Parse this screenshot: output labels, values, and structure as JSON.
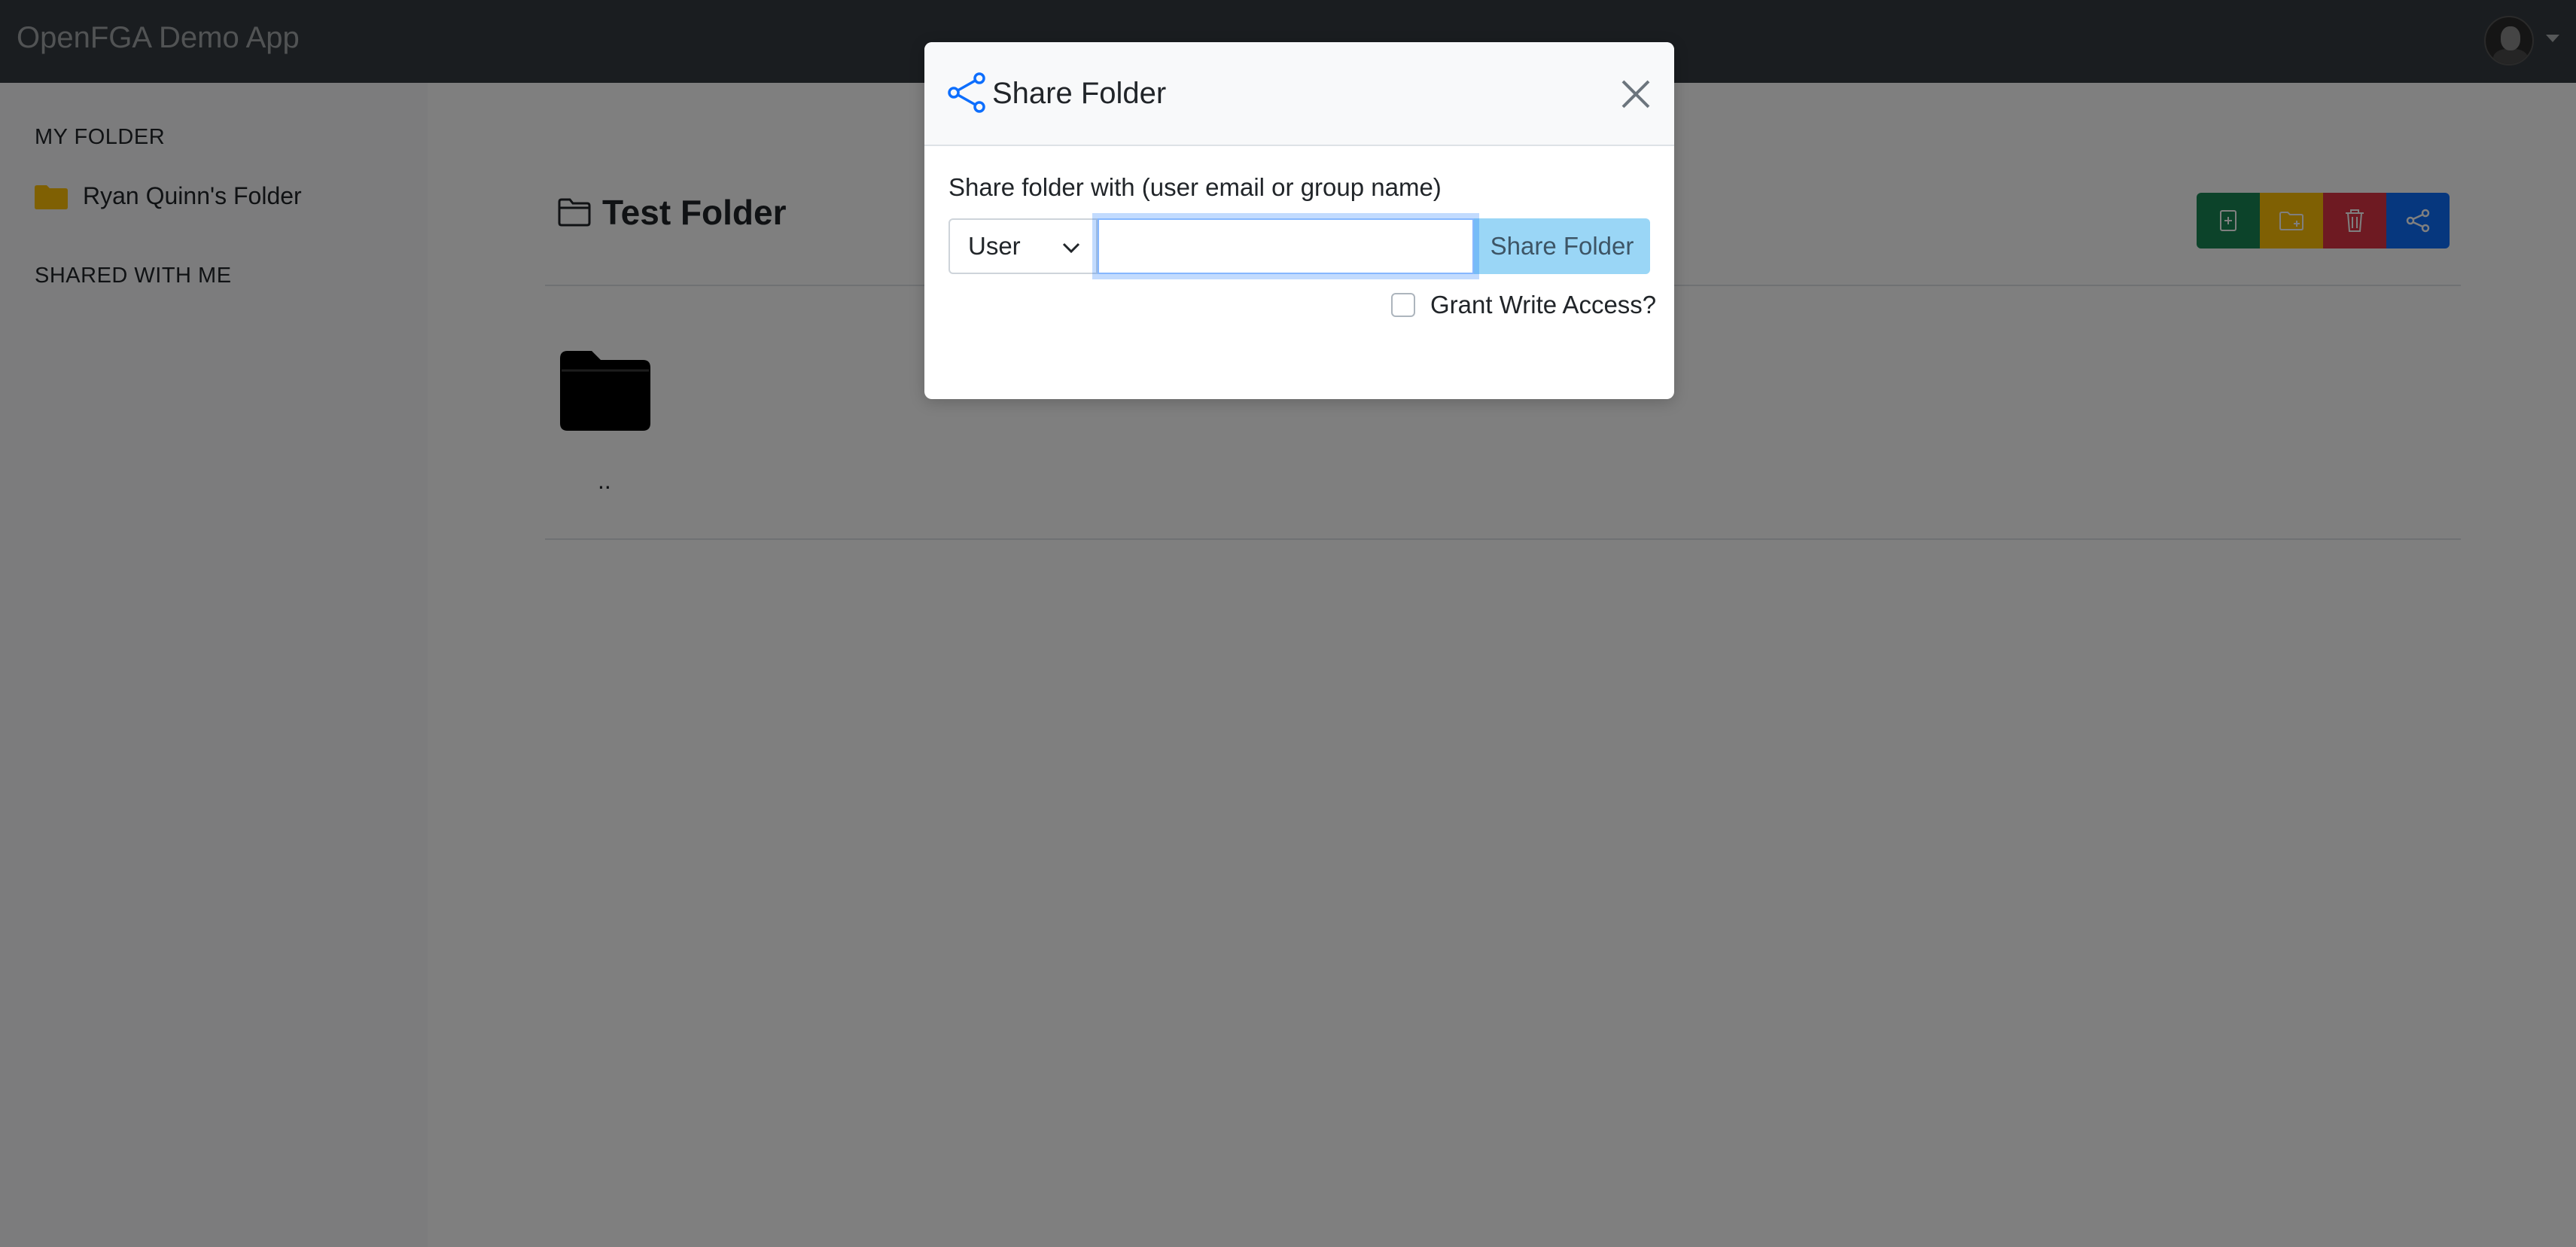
{
  "navbar": {
    "brand": "OpenFGA Demo App",
    "avatar_icon": "user-avatar"
  },
  "sidebar": {
    "my_folder_heading": "MY FOLDER",
    "my_folder_item": "Ryan Quinn's Folder",
    "shared_heading": "SHARED WITH ME"
  },
  "main": {
    "title": "Test Folder",
    "parent_folder_label": "..",
    "toolbar": [
      {
        "icon": "new-file-icon",
        "color": "#198754"
      },
      {
        "icon": "new-folder-icon",
        "color": "#ffc107"
      },
      {
        "icon": "trash-icon",
        "color": "#dc3545"
      },
      {
        "icon": "share-icon",
        "color": "#0d6efd"
      }
    ]
  },
  "modal": {
    "title": "Share Folder",
    "field_label": "Share folder with (user email or group name)",
    "select_value": "User",
    "input_value": "",
    "input_placeholder": "",
    "submit_label": "Share Folder",
    "checkbox_label": "Grant Write Access?",
    "checkbox_checked": false
  },
  "colors": {
    "accent": "#0d6efd",
    "navbar": "#343a40",
    "folder_yellow": "#ffc107"
  }
}
